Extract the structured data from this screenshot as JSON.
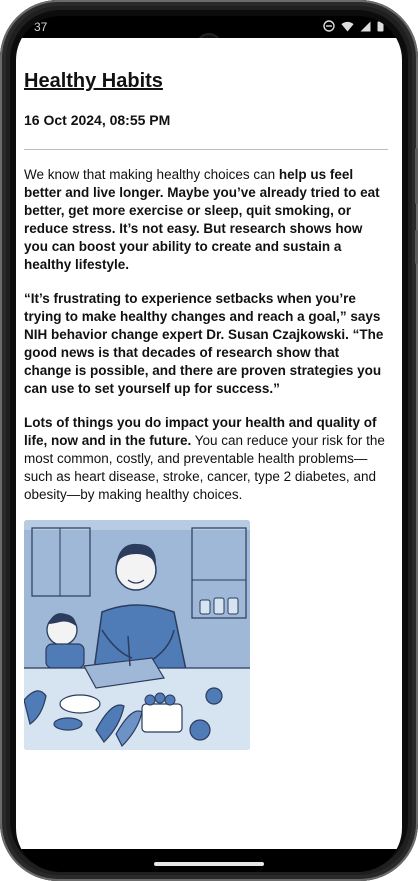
{
  "status_bar": {
    "time": "37",
    "icons": [
      "do-not-disturb-icon",
      "wifi-icon",
      "signal-icon",
      "battery-icon"
    ]
  },
  "article": {
    "title": "Healthy Habits",
    "date": "16 Oct 2024, 08:55 PM",
    "p1_regular_a": "We know that making healthy choices can ",
    "p1_bold_b": "help us feel better and live longer. Maybe you’ve already tried to eat better, get more exercise or sleep, quit smoking, or reduce stress. It’s not easy. But research shows how you can boost your ability to create and sustain a healthy lifestyle.",
    "p2_bold": "“It’s frustrating to experience setbacks when you’re trying to make healthy changes and reach a goal,” says NIH behavior change expert Dr. Susan Czajkowski. “The good news is that decades of research show that change is possible, and there are proven strategies you can use to set yourself up for success.”",
    "p3_bold": "Lots of things you do impact your health and quality of life, now and in the future.",
    "p3_regular": " You can reduce your risk for the most common, costly, and preventable health problems—such as heart disease, stroke, cancer, type 2 diabetes, and obesity—by making healthy choices."
  },
  "colors": {
    "illustration_blue": "#9fb8d8",
    "illustration_light": "#d6e3f1",
    "line": "#2b3c5c"
  }
}
